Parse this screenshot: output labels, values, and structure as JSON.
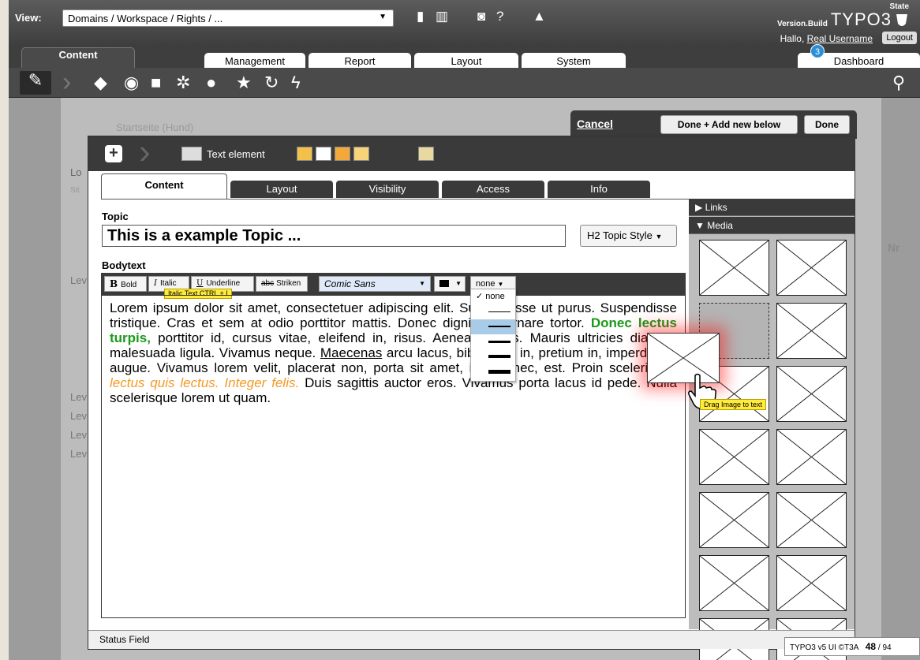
{
  "topbar": {
    "view_label": "View:",
    "view_value": "Domains / Workspace / Rights / ...",
    "brand_state": "State",
    "brand_version": "Version.Build",
    "brand_logo": "TYPO3",
    "hallo": "Hallo,",
    "username": "Real Username",
    "logout": "Logout"
  },
  "main_tabs": {
    "content": "Content",
    "management": "Management",
    "report": "Report",
    "layout": "Layout",
    "system": "System",
    "dashboard": "Dashboard",
    "badge": "3"
  },
  "background": {
    "ghost_title": "Startseite (Hund)",
    "row1": "Lo",
    "row2": "Sit",
    "level": "Lev",
    "nr": "Nr"
  },
  "actions": {
    "cancel": "Cancel",
    "done_add": "Done + Add new below",
    "done": "Done"
  },
  "editor": {
    "type_label": "Text element",
    "tabs": [
      "Content",
      "Layout",
      "Visibility",
      "Access",
      "Info"
    ],
    "topic_label": "Topic",
    "topic_value": "This is a example Topic ...",
    "topic_style": "H2 Topic Style",
    "body_label": "Bodytext",
    "toolbar": {
      "bold": "Bold",
      "italic": "Italic",
      "underline": "Underline",
      "strike": "Striken",
      "font": "Comic Sans",
      "border": "none",
      "italic_tip": "Italic Text  CTRL + I"
    },
    "border_options": [
      "none"
    ],
    "body": {
      "p1": "Lorem ipsum dolor sit amet, consectetuer adipiscing elit. Suspendisse ut purus. Suspendisse tristique. Cras et sem at odio porttitor mattis. Donec dignissim ornare tortor. ",
      "green": "Donec lectus turpis,",
      "p2": " porttitor id, cursus vitae, eleifend in, risus. Aenean turpis. Mauris ultricies diam in malesuada ligula. Vivamus neque. ",
      "underlined": "Maecenas",
      "p3": " arcu lacus, bibendum in, pretium in, imperdiet a, augue. Vivamus lorem velit, placerat non, porta sit amet, iaculis nec, est. Proin scelerisque ",
      "orange": "lectus quis lectus. Integer felis.",
      "p4": " Duis sagittis auctor eros. Vivamus porta lacus id pede. Nulla scelerisque lorem ut quam."
    },
    "status": "Status Field"
  },
  "sidebar": {
    "links": "Links",
    "media": "Media",
    "drag_tip": "Drag Image to text"
  },
  "footer": {
    "label": "TYPO3 v5 UI  ©T3A",
    "page": "48",
    "total": "/ 94"
  },
  "colors": {
    "accent_green": "#1a9a1a",
    "accent_orange": "#f29a26",
    "badge_blue": "#2a8fd6",
    "tooltip_yellow": "#ffeb3b"
  }
}
